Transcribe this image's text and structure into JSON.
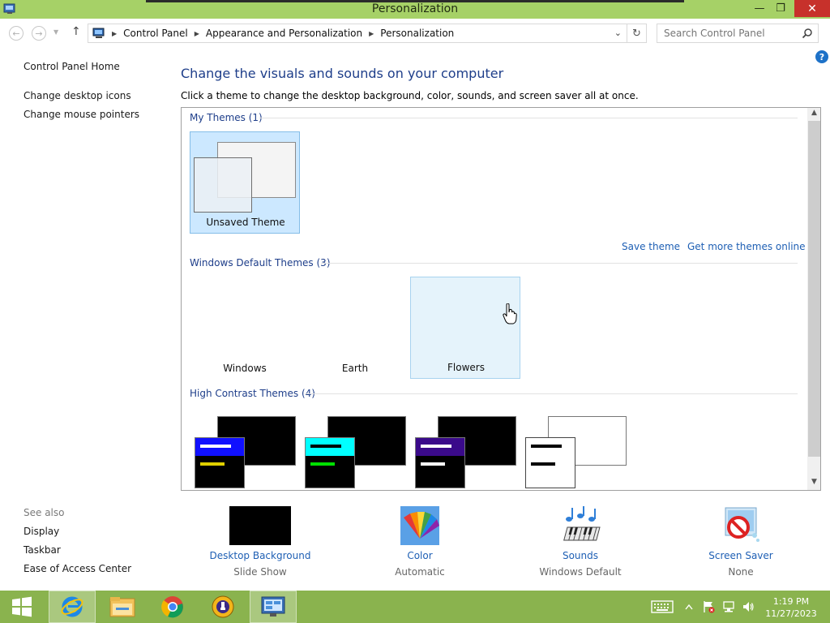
{
  "window": {
    "title": "Personalization",
    "min_glyph": "—",
    "max_glyph": "❐",
    "close_glyph": "✕"
  },
  "nav": {
    "back_glyph": "←",
    "forward_glyph": "→",
    "history_glyph": "▼",
    "up_glyph": "↑",
    "breadcrumbs": [
      "Control Panel",
      "Appearance and Personalization",
      "Personalization"
    ],
    "sep_glyph": "▶",
    "dropdown_glyph": "⌄",
    "refresh_glyph": "↻",
    "search_placeholder": "Search Control Panel"
  },
  "sidebar": {
    "home": "Control Panel Home",
    "links": [
      "Change desktop icons",
      "Change mouse pointers"
    ],
    "see_also_label": "See also",
    "see_also": [
      "Display",
      "Taskbar",
      "Ease of Access Center"
    ]
  },
  "help_glyph": "?",
  "main": {
    "title": "Change the visuals and sounds on your computer",
    "description": "Click a theme to change the desktop background, color, sounds, and screen saver all at once.",
    "my_themes_label": "My Themes (1)",
    "unsaved_theme": "Unsaved Theme",
    "save_theme": "Save theme",
    "get_more": "Get more themes online",
    "default_label": "Windows Default Themes (3)",
    "default_themes": [
      "Windows",
      "Earth",
      "Flowers"
    ],
    "hc_label": "High Contrast Themes (4)",
    "scroll_up_glyph": "▲",
    "scroll_down_glyph": "▼"
  },
  "hc_colors": [
    {
      "bar": "#1010ff",
      "line2": "#e0d000"
    },
    {
      "bar": "#00ffff",
      "line2": "#00e000"
    },
    {
      "bar": "#3a0a8a",
      "line2": "#ffffff"
    },
    {
      "bar": "#ffffff",
      "line2": "#000000"
    }
  ],
  "bottom": {
    "desktop_background": {
      "label": "Desktop Background",
      "value": "Slide Show"
    },
    "color": {
      "label": "Color",
      "value": "Automatic"
    },
    "sounds": {
      "label": "Sounds",
      "value": "Windows Default"
    },
    "screen_saver": {
      "label": "Screen Saver",
      "value": "None"
    }
  },
  "taskbar": {
    "time": "1:19 PM",
    "date": "11/27/2023"
  },
  "colors": {
    "titlebar": "#a6d167",
    "taskbar": "#8ab34e",
    "link": "#1e5fb4",
    "heading": "#1e3e8a",
    "close": "#c7312b"
  }
}
